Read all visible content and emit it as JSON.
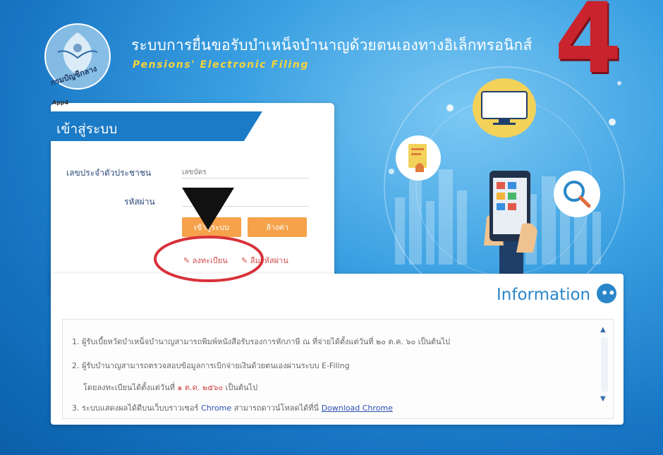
{
  "header": {
    "title": "ระบบการยื่นขอรับบำเหน็จบำนาญด้วยตนเองทางอิเล็กทรอนิกส์",
    "subtitle": "Pensions' Electronic Filing",
    "seal_text": "กรมบัญชีกลาง"
  },
  "step": {
    "number": "4"
  },
  "login": {
    "tag": "App4",
    "title": "เข้าสู่ระบบ",
    "id_label": "เลขประจำตัวประชาชน",
    "id_placeholder": "เลขบัตร",
    "password_label": "รหัสผ่าน",
    "login_button": "เข้าสู่ระบบ",
    "clear_button": "ล้างค่า",
    "register_link": "ลงทะเบียน",
    "forgot_link": "ลืมรหัสผ่าน"
  },
  "information": {
    "title": "Information",
    "lines": [
      {
        "number": "1.",
        "text": "ผู้รับเบี้ยหวัดบำเหน็จบำนาญสามารถพิมพ์หนังสือรับรองการหักภาษี ณ ที่จ่ายได้ตั้งแต่วันที่ ๒๐ ต.ค. ๖๐ เป็นต้นไป"
      },
      {
        "number": "2.",
        "text": "ผู้รับบำนาญสามารถตรวจสอบข้อมูลการเบิกจ่ายเงินด้วยตนเองผ่านระบบ E-Filing"
      },
      {
        "number": "",
        "text": "โดยลงทะเบียนได้ตั้งแต่วันที่",
        "highlight": "๑ ต.ค. ๒๕๖๐",
        "text_after": "เป็นต้นไป"
      },
      {
        "number": "3.",
        "text": "ระบบแสดงผลได้ดีบนเว็บบราวเซอร์",
        "browser_link": "Chrome",
        "text_mid": "สามารถดาวน์โหลดได้ที่นี่",
        "download_link": "Download Chrome"
      }
    ]
  },
  "annotation": {
    "highlight_target": "register-link"
  },
  "colors": {
    "background": "#1775c4",
    "accent_orange": "#f5a24b",
    "step_red": "#c9232d",
    "link_red": "#d04a4a",
    "info_blue": "#2a86c8"
  }
}
